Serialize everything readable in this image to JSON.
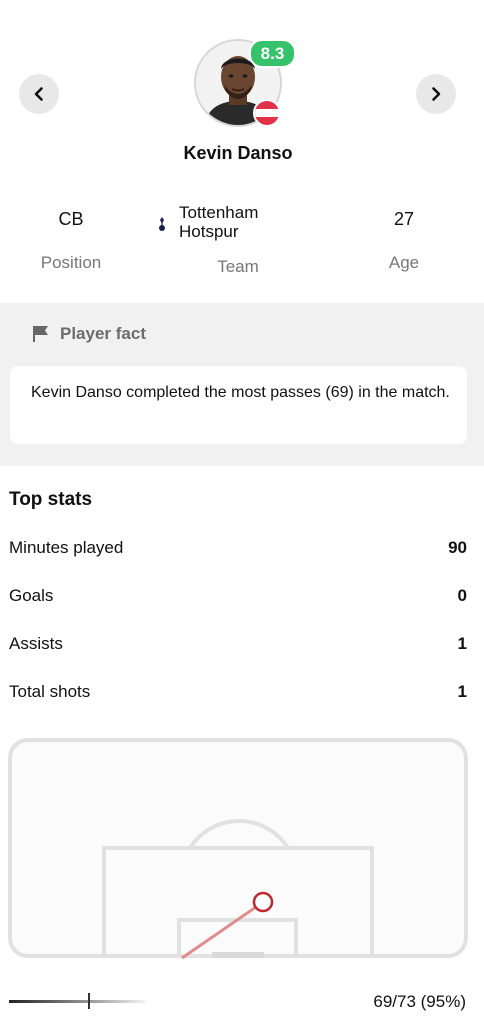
{
  "player": {
    "name": "Kevin Danso",
    "rating": "8.3",
    "rating_color": "#36c26a",
    "nationality_flag_icon": "austria-flag-icon"
  },
  "nav": {
    "prev_icon": "chevron-left-icon",
    "next_icon": "chevron-right-icon"
  },
  "info": {
    "position_value": "CB",
    "position_label": "Position",
    "team_value": "Tottenham Hotspur",
    "team_label": "Team",
    "team_crest_icon": "tottenham-crest-icon",
    "age_value": "27",
    "age_label": "Age"
  },
  "fact": {
    "title": "Player fact",
    "icon": "flag-icon",
    "text": "Kevin Danso completed the most passes (69) in the match."
  },
  "top_stats": {
    "title": "Top stats",
    "rows": [
      {
        "label": "Minutes played",
        "value": "90"
      },
      {
        "label": "Goals",
        "value": "0"
      },
      {
        "label": "Assists",
        "value": "1"
      },
      {
        "label": "Total shots",
        "value": "1"
      }
    ]
  },
  "passes": {
    "label": "69/73 (95%)",
    "accuracy_fraction": 0.95
  }
}
